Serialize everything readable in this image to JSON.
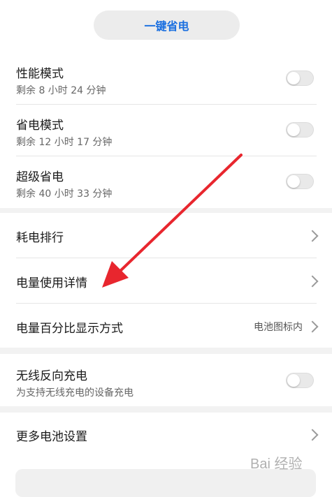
{
  "top": {
    "one_key_label": "一键省电"
  },
  "modes": [
    {
      "title": "性能模式",
      "remaining": "剩余 8 小时 24 分钟",
      "enabled": false
    },
    {
      "title": "省电模式",
      "remaining": "剩余 12 小时 17 分钟",
      "enabled": false
    },
    {
      "title": "超级省电",
      "remaining": "剩余 40 小时 33 分钟",
      "enabled": false
    }
  ],
  "menu": {
    "power_ranking": "耗电排行",
    "usage_details": "电量使用详情",
    "percentage_display": "电量百分比显示方式",
    "percentage_display_value": "电池图标内"
  },
  "wireless": {
    "title": "无线反向充电",
    "subtitle": "为支持无线充电的设备充电",
    "enabled": false
  },
  "more": {
    "label": "更多电池设置"
  },
  "watermark": {
    "text": "Bai 经验"
  },
  "colors": {
    "accent": "#1a6fe0",
    "annotation_arrow": "#e8262e"
  }
}
